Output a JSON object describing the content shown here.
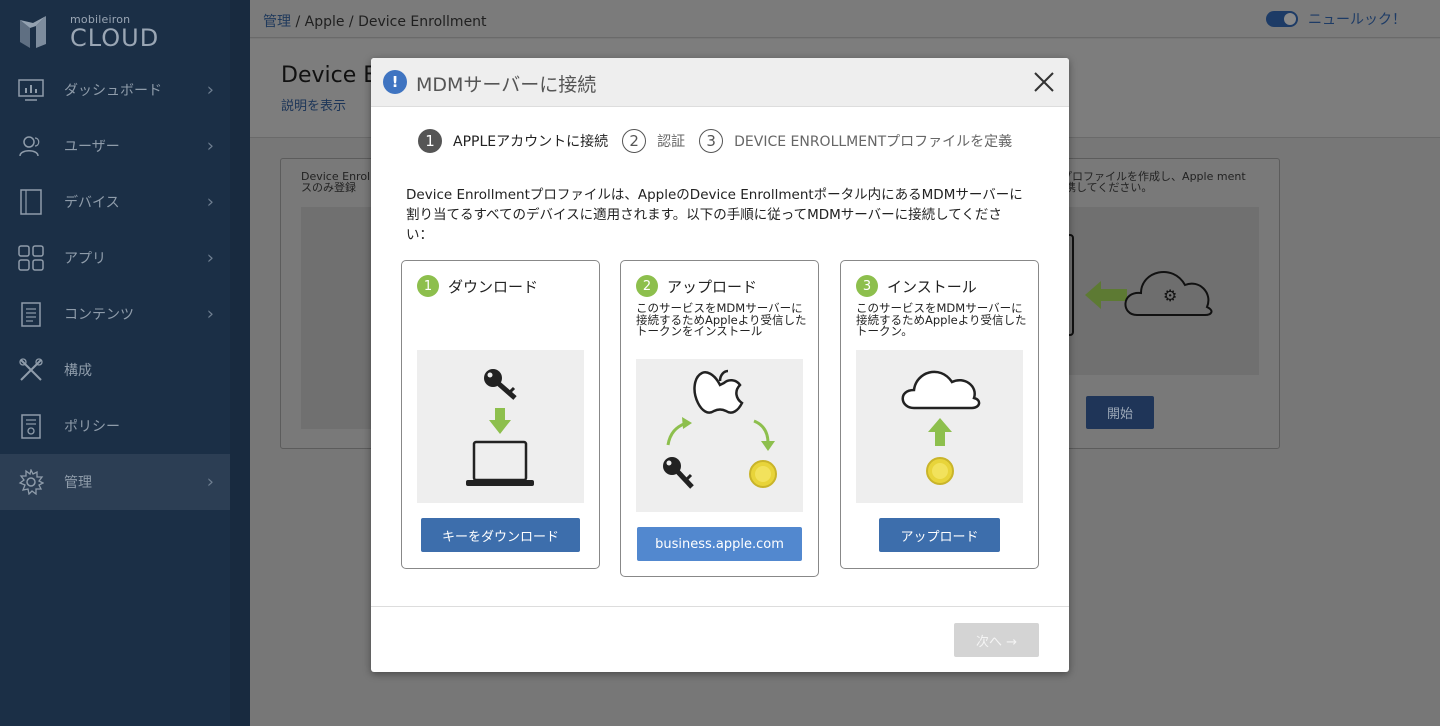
{
  "app": {
    "logo_small": "mobileiron",
    "logo_big": "CLOUD"
  },
  "sidebar": {
    "items": [
      {
        "label": "ダッシュボード",
        "icon": "dashboard-icon",
        "has_arrow": true
      },
      {
        "label": "ユーザー",
        "icon": "users-icon",
        "has_arrow": true
      },
      {
        "label": "デバイス",
        "icon": "devices-icon",
        "has_arrow": true
      },
      {
        "label": "アプリ",
        "icon": "apps-icon",
        "has_arrow": true
      },
      {
        "label": "コンテンツ",
        "icon": "content-icon",
        "has_arrow": true
      },
      {
        "label": "構成",
        "icon": "tools-icon",
        "has_arrow": false
      },
      {
        "label": "ポリシー",
        "icon": "policy-icon",
        "has_arrow": false
      },
      {
        "label": "管理",
        "icon": "gear-icon",
        "has_arrow": true,
        "active": true
      }
    ]
  },
  "topbar": {
    "breadcrumb_link": "管理",
    "breadcrumb_rest": " / Apple / Device Enrollment",
    "newlook_label": "ニュールック！"
  },
  "page": {
    "title": "Device E",
    "description_link": "説明を表示",
    "card_left_text": "Device Enrol イスのみ登録",
    "card_right_text": "entプロファイルを作成し、Apple mentに連携してください。",
    "start_button": "開始"
  },
  "modal": {
    "title": "MDMサーバーに接続",
    "steps": [
      {
        "num": "1",
        "label": "APPLEアカウントに接続",
        "current": true
      },
      {
        "num": "2",
        "label": "認証",
        "current": false
      },
      {
        "num": "3",
        "label": "DEVICE ENROLLMENTプロファイルを定義",
        "current": false
      }
    ],
    "intro": "Device Enrollmentプロファイルは、AppleのDevice Enrollmentポータル内にあるMDMサーバーに割り当てるすべてのデバイスに適用されます。以下の手順に従ってMDMサーバーに接続してください：",
    "cards": [
      {
        "num": "1",
        "title": "ダウンロード",
        "desc": "",
        "button": "キーをダウンロード"
      },
      {
        "num": "2",
        "title": "アップロード",
        "desc": "このサービスをMDMサーバーに接続するためAppleより受信したトークンをインストール",
        "button": "business.apple.com"
      },
      {
        "num": "3",
        "title": "インストール",
        "desc": "このサービスをMDMサーバーに接続するためAppleより受信したトークン。",
        "button": "アップロード"
      }
    ],
    "next_button": "次へ →"
  },
  "colors": {
    "sidebar_bg": "#1b2f46",
    "accent_blue": "#3d6eac",
    "step_green": "#8dbf4d",
    "coin_yellow": "#e8d43a"
  }
}
